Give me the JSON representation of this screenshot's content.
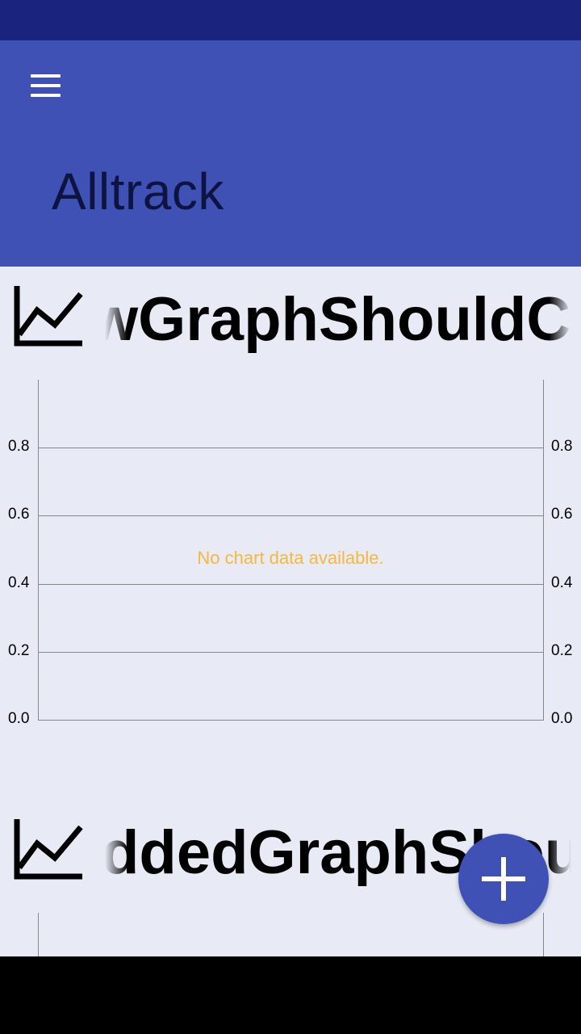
{
  "app": {
    "title": "Alltrack"
  },
  "icons": {
    "menu": "hamburger-menu-icon",
    "graph": "line-chart-icon",
    "fab": "plus-icon"
  },
  "colors": {
    "status_bar": "#1a237e",
    "app_bar": "#3f51b5",
    "background": "#e8eaf6",
    "fab": "#3f51b5",
    "no_data_text": "#f5b83d"
  },
  "graphs": [
    {
      "name": "wGraphShouldCre",
      "no_data_message": "No chart data available.",
      "y_ticks": [
        "0.8",
        "0.6",
        "0.4",
        "0.2",
        "0.0"
      ]
    },
    {
      "name": "ddedGraphShou"
    }
  ],
  "chart_data": {
    "type": "line",
    "title": "",
    "series": [],
    "ylim": [
      0,
      1
    ],
    "y_ticks": [
      0.8,
      0.6,
      0.4,
      0.2,
      0.0
    ],
    "grid": true,
    "annotation": "No chart data available."
  }
}
